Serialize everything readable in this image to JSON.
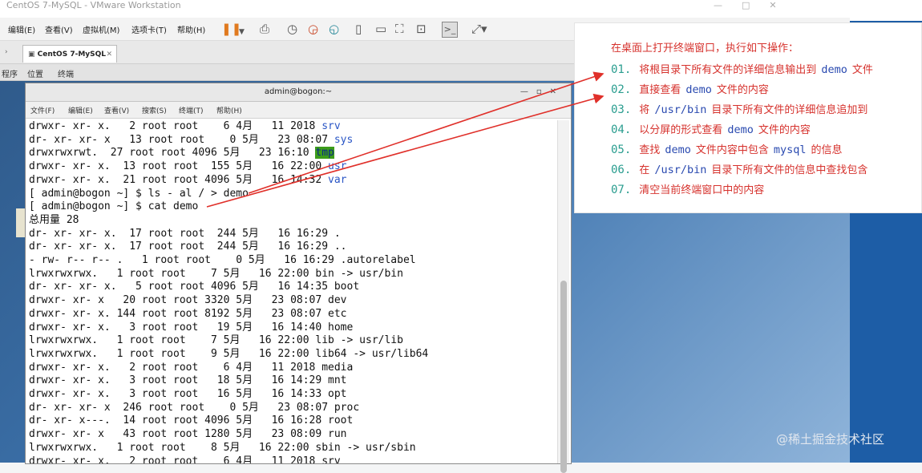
{
  "window": {
    "title": "CentOS 7-MySQL - VMware Workstation",
    "controls": [
      "—",
      "□",
      "✕"
    ]
  },
  "menubar": {
    "items": [
      "编辑(E)",
      "查看(V)",
      "虚拟机(M)",
      "选项卡(T)",
      "帮助(H)"
    ],
    "tools": [
      "pause-icon",
      "dropdown-icon",
      "send-keys-icon",
      "snapshot-icon",
      "revert-snapshot-icon",
      "manage-snapshots-icon",
      "view-console-icon",
      "view-unity-icon",
      "view-fullscreen-icon",
      "view-thumbnail-icon",
      "terminal-icon",
      "stretch-icon"
    ]
  },
  "tab": {
    "label": "CentOS 7-MySQL",
    "close": "✕"
  },
  "gnome": {
    "items": [
      "程序",
      "位置",
      "终端"
    ]
  },
  "terminal": {
    "title": "admin@bogon:~",
    "controls": [
      "—",
      "▫",
      "✕"
    ],
    "menu": [
      "文件(F)",
      "编辑(E)",
      "查看(V)",
      "搜索(S)",
      "终端(T)",
      "帮助(H)"
    ],
    "lines": [
      {
        "prefix": "drwxr- xr- x.   2 root root    6 4月   11 2018 ",
        "name": "srv",
        "style": "blue"
      },
      {
        "prefix": "dr- xr- xr- x   13 root root    0 5月   23 08:07 ",
        "name": "sys",
        "style": "blue"
      },
      {
        "prefix": "drwxrwxrwt.  27 root root 4096 5月   23 16:10 ",
        "name": "tmp",
        "style": "hl"
      },
      {
        "prefix": "drwxr- xr- x.  13 root root  155 5月   16 22:00 ",
        "name": "usr",
        "style": "blue"
      },
      {
        "prefix": "drwxr- xr- x.  21 root root 4096 5月   16 14:32 ",
        "name": "var",
        "style": "blue"
      },
      {
        "prefix": "[ admin@bogon ~] $ ls - al / > demo",
        "name": "",
        "style": ""
      },
      {
        "prefix": "[ admin@bogon ~] $ cat demo",
        "name": "",
        "style": ""
      },
      {
        "prefix": "总用量 28",
        "name": "",
        "style": ""
      },
      {
        "prefix": "dr- xr- xr- x.  17 root root  244 5月   16 16:29 .",
        "name": "",
        "style": ""
      },
      {
        "prefix": "dr- xr- xr- x.  17 root root  244 5月   16 16:29 ..",
        "name": "",
        "style": ""
      },
      {
        "prefix": "- rw- r-- r-- .   1 root root    0 5月   16 16:29 .autorelabel",
        "name": "",
        "style": ""
      },
      {
        "prefix": "lrwxrwxrwx.   1 root root    7 5月   16 22:00 bin -> usr/bin",
        "name": "",
        "style": ""
      },
      {
        "prefix": "dr- xr- xr- x.   5 root root 4096 5月   16 14:35 boot",
        "name": "",
        "style": ""
      },
      {
        "prefix": "drwxr- xr- x   20 root root 3320 5月   23 08:07 dev",
        "name": "",
        "style": ""
      },
      {
        "prefix": "drwxr- xr- x. 144 root root 8192 5月   23 08:07 etc",
        "name": "",
        "style": ""
      },
      {
        "prefix": "drwxr- xr- x.   3 root root   19 5月   16 14:40 home",
        "name": "",
        "style": ""
      },
      {
        "prefix": "lrwxrwxrwx.   1 root root    7 5月   16 22:00 lib -> usr/lib",
        "name": "",
        "style": ""
      },
      {
        "prefix": "lrwxrwxrwx.   1 root root    9 5月   16 22:00 lib64 -> usr/lib64",
        "name": "",
        "style": ""
      },
      {
        "prefix": "drwxr- xr- x.   2 root root    6 4月   11 2018 media",
        "name": "",
        "style": ""
      },
      {
        "prefix": "drwxr- xr- x.   3 root root   18 5月   16 14:29 mnt",
        "name": "",
        "style": ""
      },
      {
        "prefix": "drwxr- xr- x.   3 root root   16 5月   16 14:33 opt",
        "name": "",
        "style": ""
      },
      {
        "prefix": "dr- xr- xr- x  246 root root    0 5月   23 08:07 proc",
        "name": "",
        "style": ""
      },
      {
        "prefix": "dr- xr- x---.  14 root root 4096 5月   16 16:28 root",
        "name": "",
        "style": ""
      },
      {
        "prefix": "drwxr- xr- x   43 root root 1280 5月   23 08:09 run",
        "name": "",
        "style": ""
      },
      {
        "prefix": "lrwxrwxrwx.   1 root root    8 5月   16 22:00 sbin -> usr/sbin",
        "name": "",
        "style": ""
      },
      {
        "prefix": "drwxr- xr- x.   2 root root    6 4月   11 2018 srv",
        "name": "",
        "style": ""
      }
    ]
  },
  "panel": {
    "heading": "在桌面上打开终端窗口，执行如下操作：",
    "tasks": [
      {
        "num": "01.",
        "before": "将根目录下所有文件的详细信息输出到",
        "code": "demo",
        "after": "文件"
      },
      {
        "num": "02.",
        "before": "直接查看",
        "code": "demo",
        "after": "文件的内容"
      },
      {
        "num": "03.",
        "before": "将",
        "code": "/usr/bin",
        "after": "目录下所有文件的详细信息追加到"
      },
      {
        "num": "04.",
        "before": "以分屏的形式查看",
        "code": "demo",
        "after": "文件的内容"
      },
      {
        "num": "05.",
        "before": "查找",
        "code": "demo",
        "after": "文件内容中包含",
        "code2": "mysql",
        "after2": "的信息"
      },
      {
        "num": "06.",
        "before": "在",
        "code": "/usr/bin",
        "after": "目录下所有文件的信息中查找包含"
      },
      {
        "num": "07.",
        "before": "清空当前终端窗口中的内容",
        "code": "",
        "after": ""
      }
    ]
  },
  "watermark": "@稀土掘金技术社区",
  "colors": {
    "task_text": "#d6322d",
    "task_num": "#2a9d8f",
    "code": "#2a4ab0",
    "arrow": "#e0302a",
    "dir_blue": "#2a56c6",
    "tmp_bg": "#3c9c1a"
  }
}
